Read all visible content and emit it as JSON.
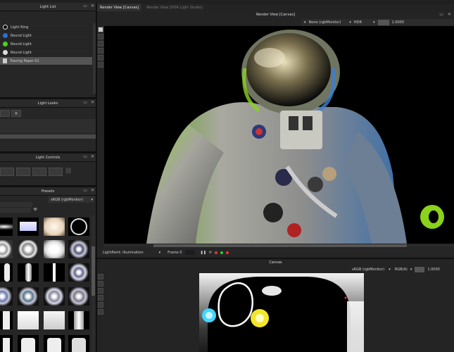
{
  "light_list": {
    "title": "Light List",
    "items": [
      {
        "label": "Light Ring",
        "icon": "ring-light-icon",
        "color": "#111111"
      },
      {
        "label": "Round Light",
        "icon": "blue-light-icon",
        "color": "#2a6fd6"
      },
      {
        "label": "Round Light",
        "icon": "green-light-icon",
        "color": "#4cd11d"
      },
      {
        "label": "Round Light",
        "icon": "white-light-icon",
        "color": "#dddddd"
      },
      {
        "label": "Tracing Paper 01",
        "icon": "paper-icon",
        "color": "#cccccc"
      }
    ]
  },
  "light_looks": {
    "title": "Light Looks"
  },
  "light_controls": {
    "title": "Light Controls"
  },
  "presets": {
    "title": "Presets",
    "colorspace": "sRGB (rgbMonitor)"
  },
  "render_view": {
    "tabs": [
      "Render View [Canvas]",
      "Render View [HDR Light Studio]"
    ],
    "title": "Render View [Canvas]",
    "display": "None (rgbMonitor)",
    "channel": "HDR",
    "exposure": "1.0000",
    "status_label": "LightPaint: Illumination",
    "frame": "Frame 0"
  },
  "canvas": {
    "title": "Canvas",
    "colorspace": "sRGB (rgbMonitor)",
    "channel": "RGB(A)",
    "exposure": "1.0000"
  },
  "colors": {
    "accent_green": "#8bd31a",
    "panel": "#262626",
    "header": "#2a2a2a"
  }
}
